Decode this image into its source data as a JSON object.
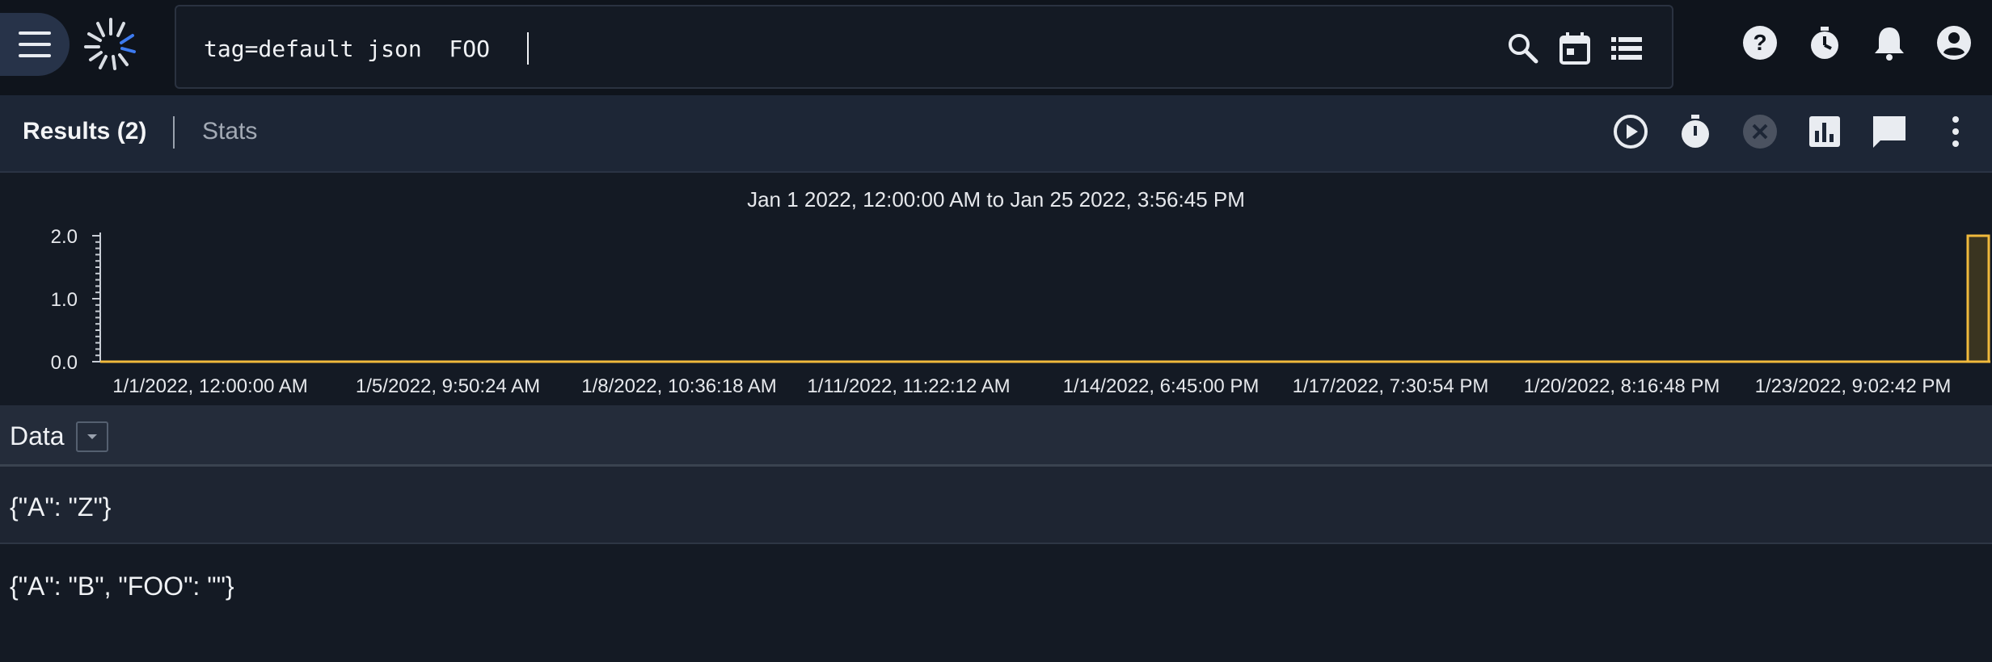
{
  "search": {
    "query": "tag=default json  FOO"
  },
  "toolbar": {
    "results_label": "Results (2)",
    "stats_label": "Stats"
  },
  "chart_data": {
    "type": "bar",
    "title": "Jan 1 2022, 12:00:00 AM to Jan 25 2022, 3:56:45 PM",
    "xlabel": "",
    "ylabel": "",
    "ylim": [
      0,
      2
    ],
    "y_ticks": [
      "2.0",
      "1.0",
      "0.0"
    ],
    "x_ticks": [
      "1/1/2022, 12:00:00 AM",
      "1/5/2022, 9:50:24 AM",
      "1/8/2022, 10:36:18 AM",
      "1/11/2022, 11:22:12 AM",
      "1/14/2022, 6:45:00 PM",
      "1/17/2022, 7:30:54 PM",
      "1/20/2022, 8:16:48 PM",
      "1/23/2022, 9:02:42 PM"
    ],
    "bars": [
      {
        "x_start": "1/25/2022, 3:22:00 PM",
        "x_end": "1/25/2022, 3:56:45 PM",
        "value": 2
      }
    ],
    "grid": false,
    "color": "#f0b93c"
  },
  "data_table": {
    "header": "Data",
    "rows": [
      "{\"A\": \"Z\"}",
      "{\"A\": \"B\", \"FOO\": \"\"}"
    ]
  },
  "colors": {
    "accent_bar": "#f0b93c",
    "logo_accent": "#3d7bf0"
  }
}
